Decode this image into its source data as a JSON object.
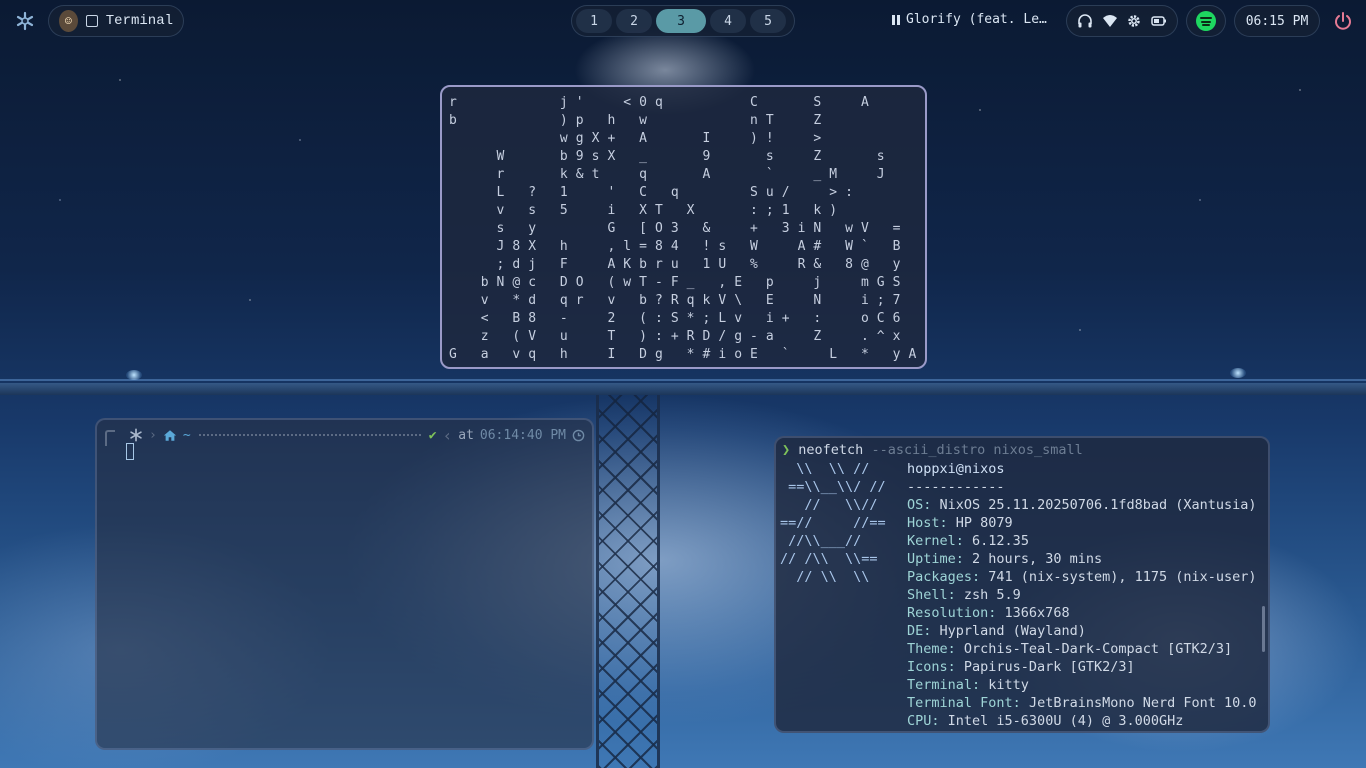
{
  "topbar": {
    "active_window_title": "Terminal",
    "workspaces": [
      "1",
      "2",
      "3",
      "4",
      "5"
    ],
    "active_workspace": "3",
    "media_title": "Glorify (feat. Le…",
    "clock": "06:15 PM",
    "icons": [
      "nixos-snowflake-icon",
      "headphones-icon",
      "wifi-icon",
      "settings-gear-icon",
      "battery-icon",
      "spotify-icon",
      "power-icon"
    ],
    "accent": "#5a9aa6"
  },
  "matrix_rows": [
    "r      j'  <0q     C   S  A   ",
    "b      )p h w      nT  Z     ",
    "       wgX+ A   I  )!  >     ",
    "   W   b9sX _   9   s  Z   s ",
    "   r   k&t  q   A   `  _M  J ",
    "   L ? 1  ' C q    Su/  >:  ",
    "   v s 5  i XT X   :;1 k)   ",
    "   s y    G [O3 &  + 3iN wV = ",
    "   J8X h  ,l=84 !s W  A# W` B",
    "   ;dj F  AKbru 1U %  R& 8@ y",
    "  bN@c DO (wT-F_ ,E p  j  mGS",
    "  v *d qr v b?RqkV\\ E  N  i;7",
    "  < B8 -  2 (:S*;Lv i+ :  oC6",
    "  z (V u  T ):+RD/g-a  Z  .^x",
    "G a vq h  I Dg *#ioE `  L * yA5"
  ],
  "zsh": {
    "path": "~",
    "status": "✔",
    "at_label": "at",
    "time": "06:14:40 PM"
  },
  "neofetch": {
    "prompt": "❯",
    "command": "neofetch",
    "args": "--ascii_distro nixos_small",
    "logo": [
      "  \\\\  \\\\ //",
      " ==\\\\__\\\\/ //",
      "   //   \\\\//",
      "==//     //==",
      " //\\\\___//",
      "// /\\\\  \\\\==",
      "  // \\\\  \\\\"
    ],
    "user": "hoppxi@nixos",
    "separator": "------------",
    "info": [
      {
        "key": "OS",
        "value": "NixOS 25.11.20250706.1fd8bad (Xantusia)"
      },
      {
        "key": "Host",
        "value": "HP 8079"
      },
      {
        "key": "Kernel",
        "value": "6.12.35"
      },
      {
        "key": "Uptime",
        "value": "2 hours, 30 mins"
      },
      {
        "key": "Packages",
        "value": "741 (nix-system), 1175 (nix-user)"
      },
      {
        "key": "Shell",
        "value": "zsh 5.9"
      },
      {
        "key": "Resolution",
        "value": "1366x768"
      },
      {
        "key": "DE",
        "value": "Hyprland (Wayland)"
      },
      {
        "key": "Theme",
        "value": "Orchis-Teal-Dark-Compact [GTK2/3]"
      },
      {
        "key": "Icons",
        "value": "Papirus-Dark [GTK2/3]"
      },
      {
        "key": "Terminal",
        "value": "kitty"
      },
      {
        "key": "Terminal Font",
        "value": "JetBrainsMono Nerd Font 10.0"
      },
      {
        "key": "CPU",
        "value": "Intel i5-6300U (4) @ 3.000GHz"
      }
    ]
  }
}
